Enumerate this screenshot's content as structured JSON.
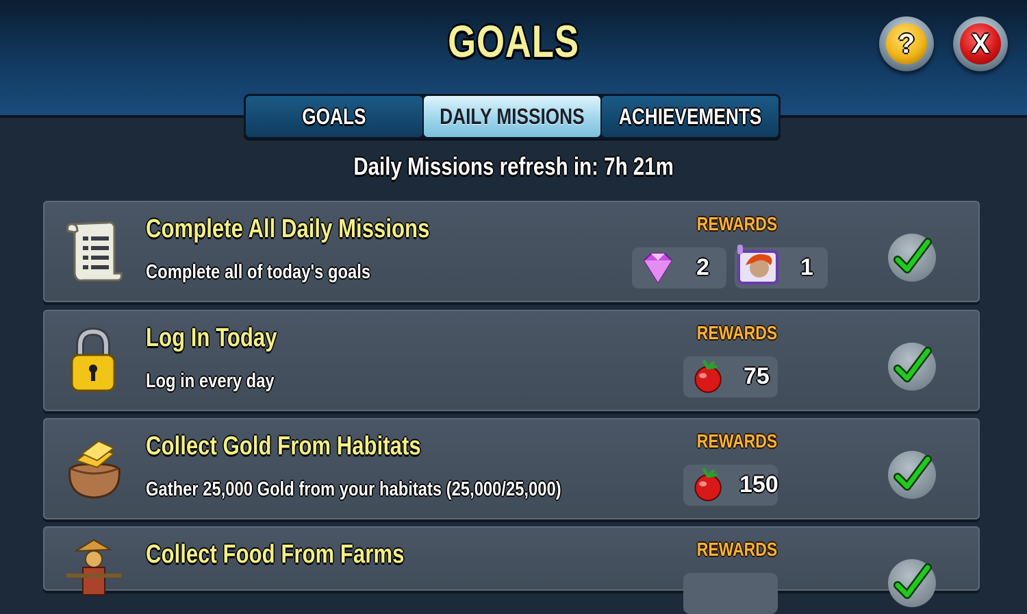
{
  "header": {
    "title": "GOALS",
    "help_symbol": "?",
    "close_symbol": "X"
  },
  "tabs": [
    {
      "label": "GOALS",
      "active": false
    },
    {
      "label": "DAILY MISSIONS",
      "active": true
    },
    {
      "label": "ACHIEVEMENTS",
      "active": false
    }
  ],
  "refresh_text": "Daily Missions refresh in: 7h 21m",
  "missions": [
    {
      "icon": "scroll-icon",
      "title": "Complete All Daily Missions",
      "description": "Complete all of today's goals",
      "rewards_label": "REWARDS",
      "rewards": [
        {
          "icon": "gem-icon",
          "amount": "2"
        },
        {
          "icon": "monster-portrait-icon",
          "amount": "1"
        }
      ],
      "completed": true
    },
    {
      "icon": "padlock-icon",
      "title": "Log In Today",
      "description": "Log in every day",
      "rewards_label": "REWARDS",
      "rewards": [
        {
          "icon": "food-tomato-icon",
          "amount": "75"
        }
      ],
      "completed": true
    },
    {
      "icon": "gold-sack-icon",
      "title": "Collect Gold From Habitats",
      "description": "Gather 25,000 Gold from your habitats (25,000/25,000)",
      "rewards_label": "REWARDS",
      "rewards": [
        {
          "icon": "food-tomato-icon",
          "amount": "150"
        }
      ],
      "completed": true
    },
    {
      "icon": "scarecrow-icon",
      "title": "Collect Food From Farms",
      "rewards_label": "REWARDS"
    }
  ],
  "colors": {
    "title_yellow": "#f3ef9a",
    "mission_title": "#f4ef86",
    "rewards_orange": "#f4b33c",
    "check_green": "#1fc41f",
    "active_tab": "#9fd6ec"
  }
}
